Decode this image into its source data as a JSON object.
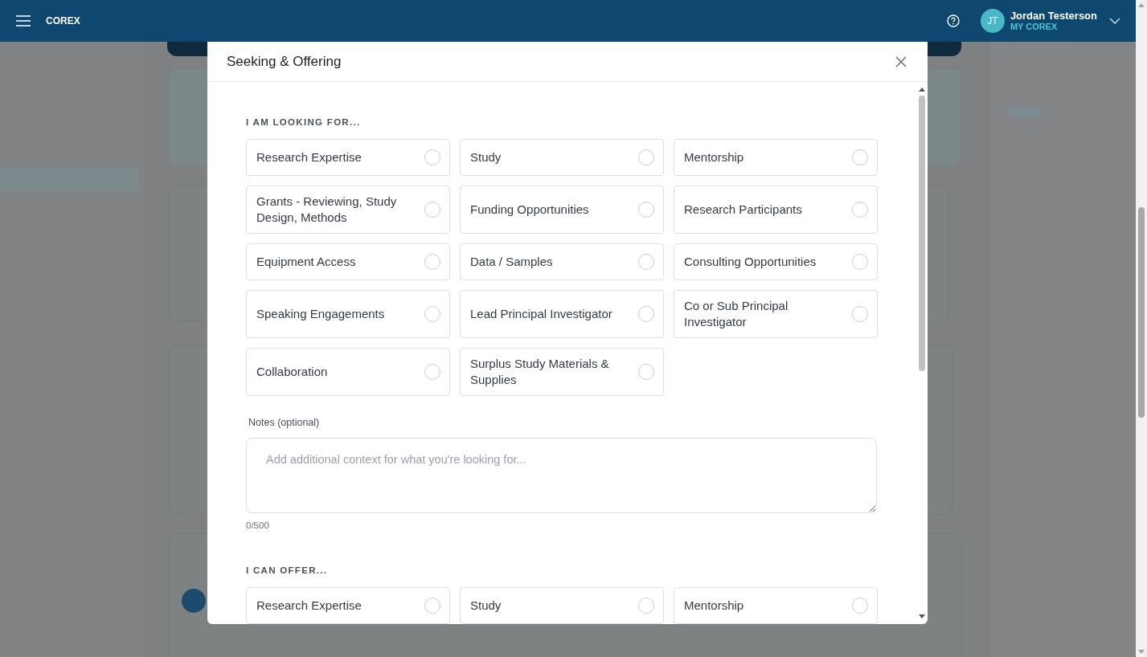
{
  "header": {
    "brand": "COREX",
    "user": {
      "initials": "JT",
      "name": "Jordan Testerson",
      "subtitle": "MY COREX"
    }
  },
  "modal": {
    "title": "Seeking & Offering",
    "sections": [
      {
        "heading": "I AM LOOKING FOR...",
        "options": [
          {
            "label": "Research Expertise",
            "selected": false
          },
          {
            "label": "Study",
            "selected": false
          },
          {
            "label": "Mentorship",
            "selected": false
          },
          {
            "label": "Grants - Reviewing, Study Design, Methods",
            "selected": false
          },
          {
            "label": "Funding Opportunities",
            "selected": false
          },
          {
            "label": "Research Participants",
            "selected": false
          },
          {
            "label": "Equipment Access",
            "selected": false
          },
          {
            "label": "Data / Samples",
            "selected": false
          },
          {
            "label": "Consulting Opportunities",
            "selected": false
          },
          {
            "label": "Speaking Engagements",
            "selected": false
          },
          {
            "label": "Lead Principal Investigator",
            "selected": false
          },
          {
            "label": "Co or Sub Principal Investigator",
            "selected": false
          },
          {
            "label": "Collaboration",
            "selected": false
          },
          {
            "label": "Surplus Study Materials & Supplies",
            "selected": false
          }
        ],
        "notes": {
          "label": "Notes (optional)",
          "placeholder": "Add additional context for what you're looking for...",
          "counter": "0/500"
        }
      },
      {
        "heading": "I CAN OFFER...",
        "options": [
          {
            "label": "Research Expertise",
            "selected": false
          },
          {
            "label": "Study",
            "selected": false
          },
          {
            "label": "Mentorship",
            "selected": false
          }
        ]
      }
    ]
  }
}
